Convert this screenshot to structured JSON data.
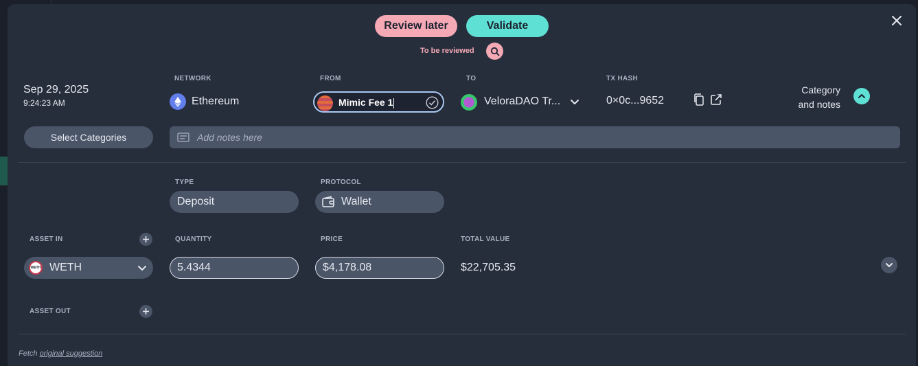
{
  "actions": {
    "review_later": "Review later",
    "validate": "Validate",
    "status": "To be reviewed"
  },
  "transaction": {
    "date": "Sep 29, 2025",
    "time": "9:24:23 AM",
    "network_label": "NETWORK",
    "network": "Ethereum",
    "from_label": "FROM",
    "from_value": "Mimic Fee 1",
    "to_label": "TO",
    "to_value": "VeloraDAO Tr...",
    "txhash_label": "TX HASH",
    "txhash": "0×0c...9652",
    "category_notes": "Category and notes"
  },
  "categories": {
    "select_label": "Select Categories",
    "notes_placeholder": "Add notes here"
  },
  "details": {
    "type_label": "TYPE",
    "type_value": "Deposit",
    "protocol_label": "PROTOCOL",
    "protocol_value": "Wallet",
    "asset_in_label": "ASSET IN",
    "asset_out_label": "ASSET OUT",
    "quantity_label": "QUANTITY",
    "price_label": "PRICE",
    "total_label": "TOTAL VALUE",
    "asset": "WETH",
    "asset_icon_text": "WETH",
    "quantity": "5.4344",
    "price": "$4,178.08",
    "total": "$22,705.35"
  },
  "footer": {
    "fetch_text": "Fetch",
    "link_text": "original suggestion"
  },
  "colors": {
    "review": "#f4a9b5",
    "validate": "#5fe0d4",
    "modal_bg": "#262d3b",
    "field_bg": "#4b5568",
    "ethereum": "#627eea"
  },
  "icons": [
    "close-icon",
    "search-icon",
    "ethereum-icon",
    "check-circle-icon",
    "chevron-down-icon",
    "copy-icon",
    "external-link-icon",
    "chevron-up-icon",
    "notes-icon",
    "wallet-icon",
    "plus-icon",
    "weth-icon"
  ]
}
